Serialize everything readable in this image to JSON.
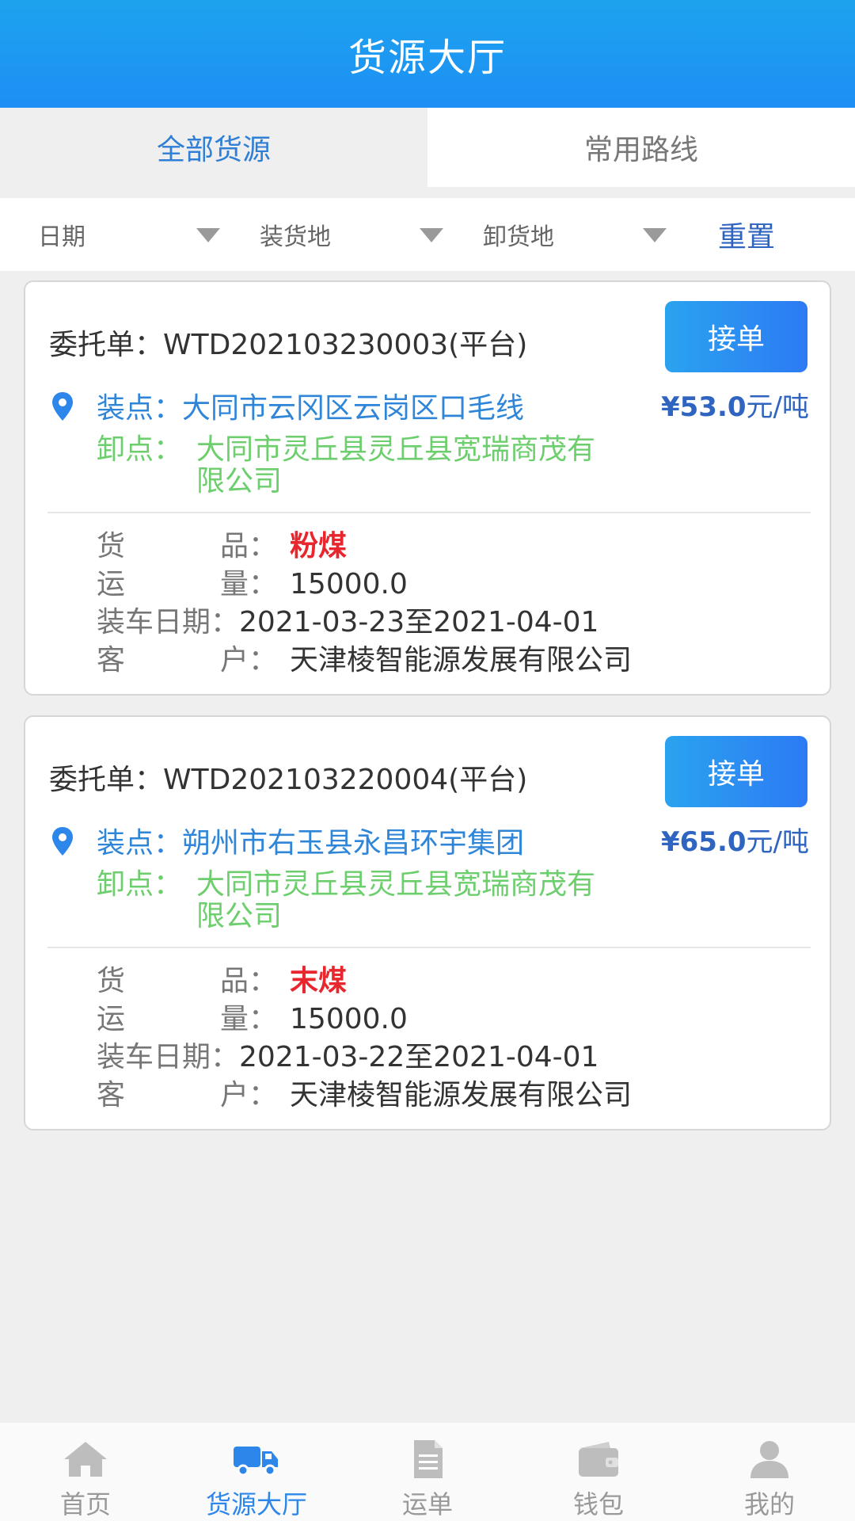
{
  "header": {
    "title": "货源大厅"
  },
  "tabs": [
    {
      "label": "全部货源",
      "active": true
    },
    {
      "label": "常用路线",
      "active": false
    }
  ],
  "filters": {
    "date": "日期",
    "load_place": "装货地",
    "unload_place": "卸货地",
    "reset": "重置"
  },
  "cards": [
    {
      "order_label": "委托单：",
      "order_no": "WTD202103230003(平台)",
      "accept": "接单",
      "load_label": "装点：",
      "load_place": "大同市云冈区云岗区口毛线",
      "price": "¥53.0",
      "price_unit": "元/吨",
      "unload_label": "卸点：",
      "unload_place": "大同市灵丘县灵丘县宽瑞商茂有限公司",
      "goods_key": [
        "货",
        "品",
        "："
      ],
      "goods": "粉煤",
      "volume_key": [
        "运",
        "量",
        "："
      ],
      "volume": "15000.0",
      "date_key": "装车日期：",
      "date": "2021-03-23至2021-04-01",
      "customer_key": [
        "客",
        "户",
        "："
      ],
      "customer": "天津棱智能源发展有限公司"
    },
    {
      "order_label": "委托单：",
      "order_no": "WTD202103220004(平台)",
      "accept": "接单",
      "load_label": "装点：",
      "load_place": "朔州市右玉县永昌环宇集团",
      "price": "¥65.0",
      "price_unit": "元/吨",
      "unload_label": "卸点：",
      "unload_place": "大同市灵丘县灵丘县宽瑞商茂有限公司",
      "goods_key": [
        "货",
        "品",
        "："
      ],
      "goods": "末煤",
      "volume_key": [
        "运",
        "量",
        "："
      ],
      "volume": "15000.0",
      "date_key": "装车日期：",
      "date": "2021-03-22至2021-04-01",
      "customer_key": [
        "客",
        "户",
        "："
      ],
      "customer": "天津棱智能源发展有限公司"
    }
  ],
  "bottom_nav": [
    {
      "label": "首页",
      "icon": "home-icon",
      "active": false
    },
    {
      "label": "货源大厅",
      "icon": "truck-icon",
      "active": true
    },
    {
      "label": "运单",
      "icon": "document-icon",
      "active": false
    },
    {
      "label": "钱包",
      "icon": "wallet-icon",
      "active": false
    },
    {
      "label": "我的",
      "icon": "user-icon",
      "active": false
    }
  ],
  "colors": {
    "primary": "#1d8ff5",
    "load_text": "#2f86d8",
    "unload_text": "#6cce6c",
    "goods_text": "#e8262d",
    "price_text": "#2f64c0"
  }
}
